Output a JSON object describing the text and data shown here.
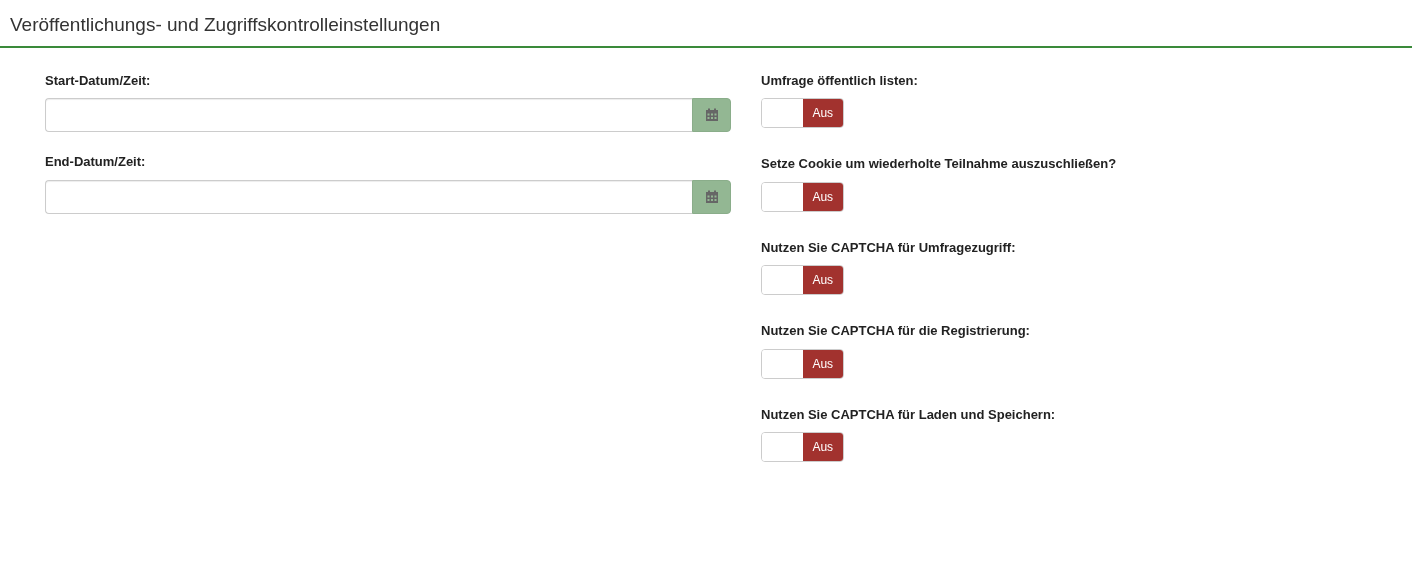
{
  "title": "Veröffentlichungs- und Zugriffskontrolleinstellungen",
  "date_fields": [
    {
      "label": "Start-Datum/Zeit:"
    },
    {
      "label": "End-Datum/Zeit:"
    }
  ],
  "toggles": [
    {
      "label": "Umfrage öffentlich listen:",
      "on": false,
      "state_text": "Aus"
    },
    {
      "label": "Setze Cookie um wiederholte Teilnahme auszuschließen?",
      "on": false,
      "state_text": "Aus"
    },
    {
      "label": "Nutzen Sie CAPTCHA für Umfragezugriff:",
      "on": false,
      "state_text": "Aus"
    },
    {
      "label": "Nutzen Sie CAPTCHA für die Registrierung:",
      "on": false,
      "state_text": "Aus"
    },
    {
      "label": "Nutzen Sie CAPTCHA für Laden und Speichern:",
      "on": false,
      "state_text": "Aus"
    }
  ]
}
